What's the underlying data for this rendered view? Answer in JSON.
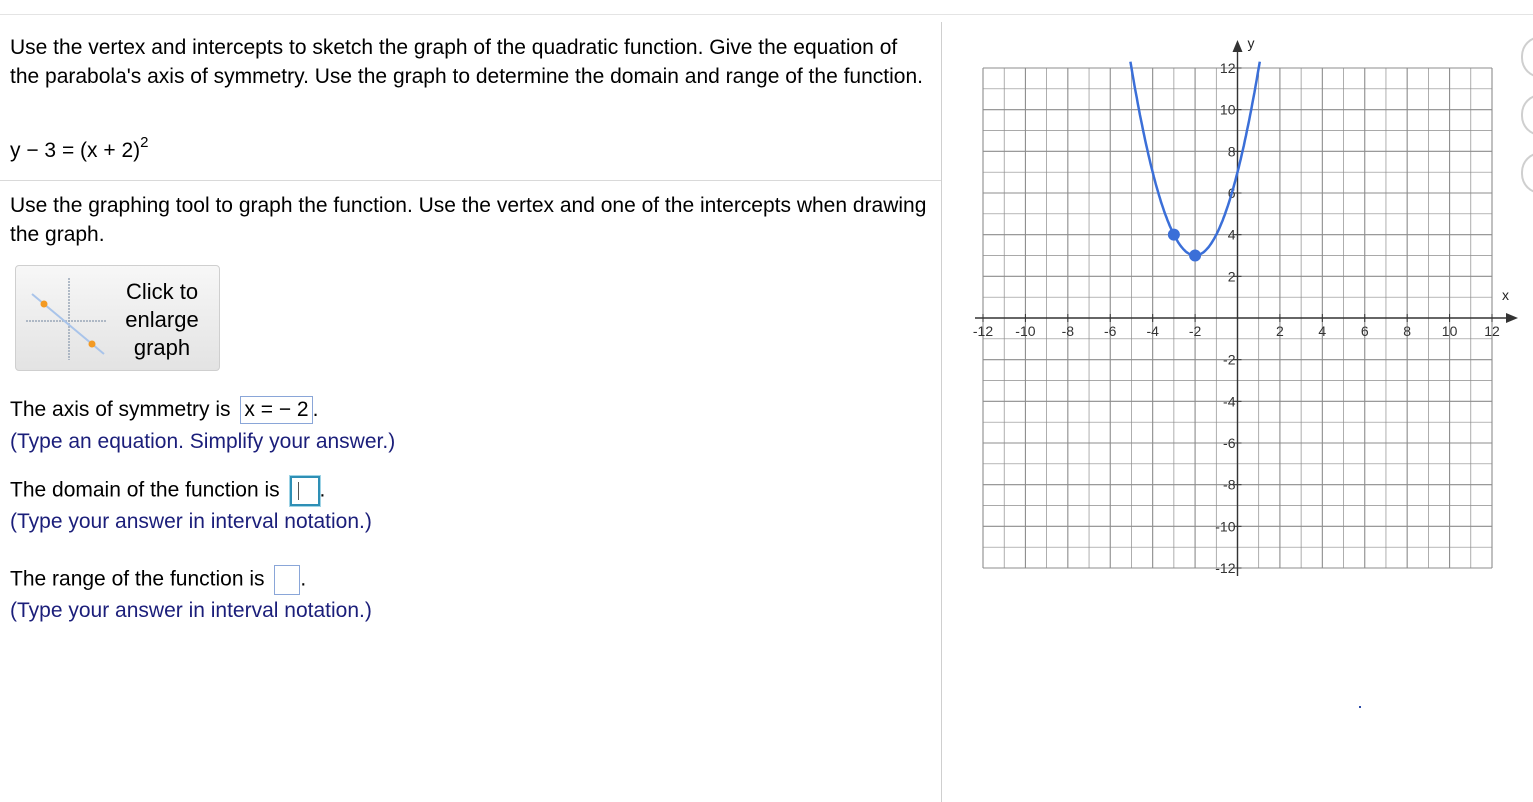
{
  "question": {
    "paragraph1": "Use the vertex and intercepts to sketch the graph of the quadratic function.  Give the equation of the parabola's axis of symmetry. Use the graph to determine the domain and range of the function.",
    "equation_base": "y − 3 = (x + 2)",
    "equation_exponent": "2",
    "paragraph2": "Use the graphing tool to graph the function.  Use the vertex and one of the intercepts when drawing the graph."
  },
  "enlarge_button": {
    "label": "Click to enlarge graph"
  },
  "answers": {
    "axis_prefix": "The axis of symmetry is",
    "axis_value": "x =  − 2",
    "axis_suffix": ".",
    "axis_hint": "(Type an equation. Simplify your answer.)",
    "domain_prefix": "The domain of the function is",
    "domain_value": "",
    "domain_suffix": ".",
    "domain_hint": "(Type your answer in interval notation.)",
    "range_prefix": "The range of the function is",
    "range_value": "",
    "range_suffix": ".",
    "range_hint": "(Type your answer in interval notation.)"
  },
  "graph": {
    "x_axis_label": "x",
    "y_axis_label": "y",
    "x_ticks": [
      "-12",
      "-10",
      "-8",
      "-6",
      "-4",
      "-2",
      "2",
      "4",
      "6",
      "8",
      "10",
      "12"
    ],
    "y_ticks": [
      "12",
      "10",
      "8",
      "6",
      "4",
      "2",
      "-2",
      "-4",
      "-6",
      "-8",
      "-10",
      "-12"
    ],
    "xlim": [
      -12,
      12
    ],
    "ylim": [
      -12,
      12
    ],
    "curve_color": "#3b6fd8",
    "function": "y = (x + 2)^2 + 3",
    "plotted_points": [
      {
        "x": -2,
        "y": 3
      },
      {
        "x": -3,
        "y": 4
      }
    ]
  }
}
